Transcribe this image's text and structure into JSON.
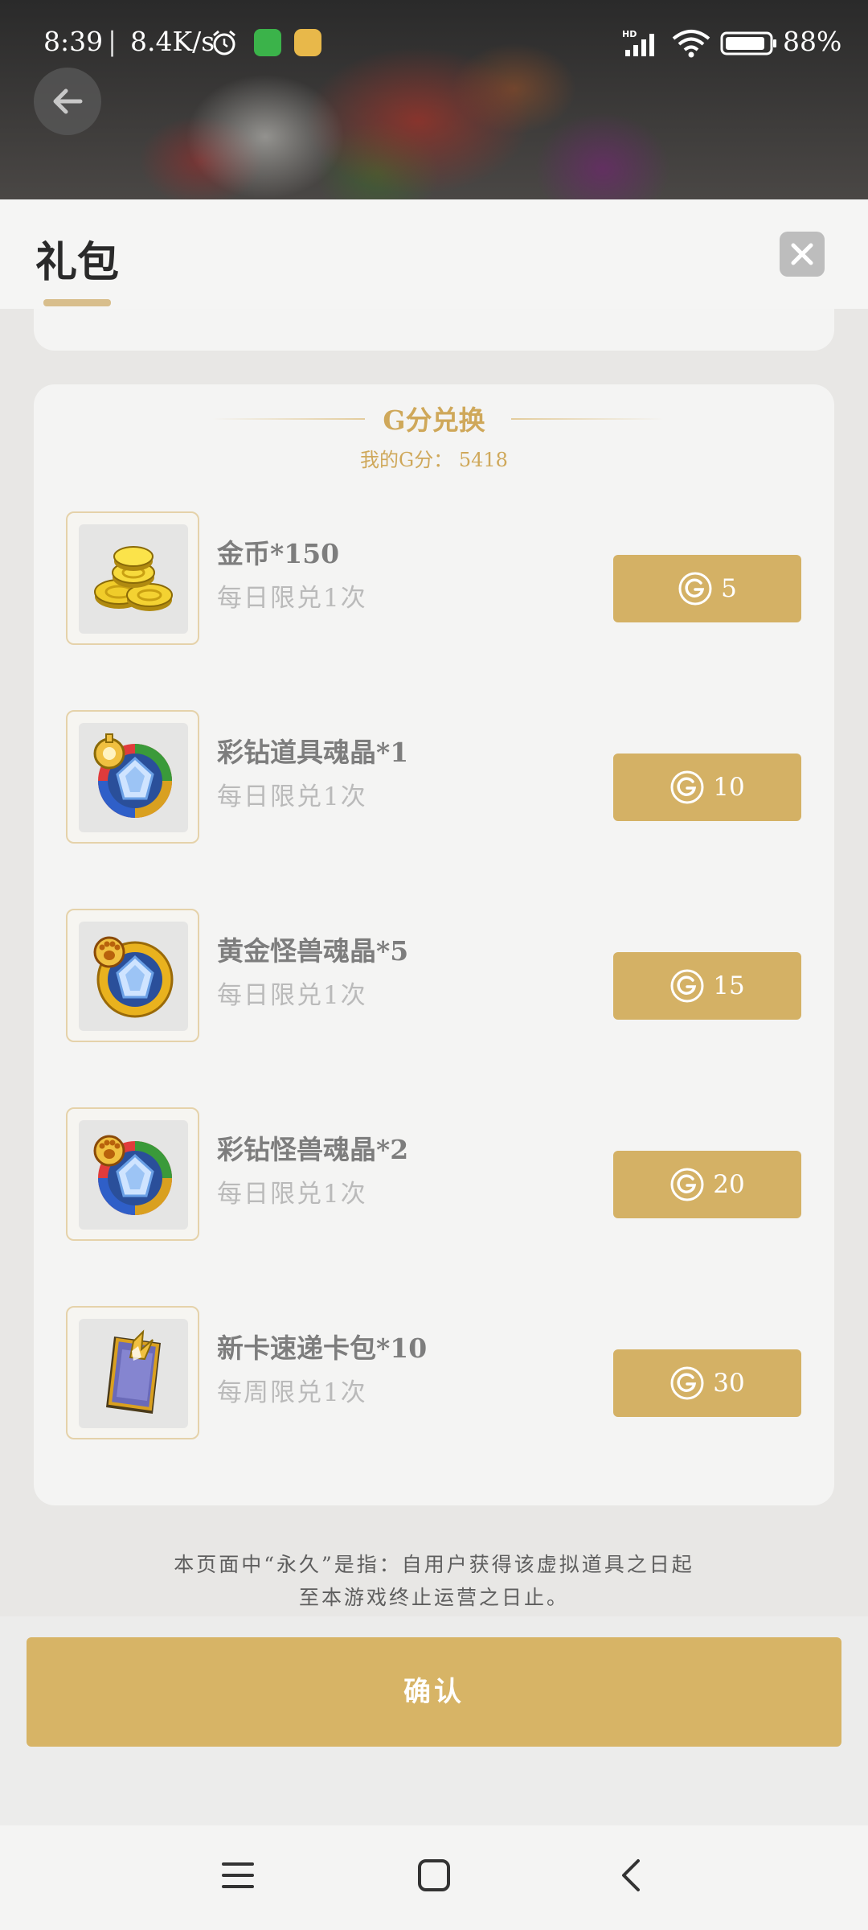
{
  "status_bar": {
    "time": "8:39",
    "separator": "|",
    "net_speed": "8.4K/s",
    "battery": "88%",
    "icons": [
      "alarm-icon",
      "app-icon",
      "game-app-icon",
      "hd-signal-icon",
      "wifi-icon",
      "battery-icon"
    ]
  },
  "header": {
    "title": "礼包"
  },
  "section": {
    "title": "G分兑换",
    "my_points": "我的G分： 5418"
  },
  "items": [
    {
      "name": "金币*150",
      "limit": "每日限兑1次",
      "cost": "5",
      "icon": "gold-coins-icon"
    },
    {
      "name": "彩钻道具魂晶*1",
      "limit": "每日限兑1次",
      "cost": "10",
      "icon": "rainbow-prop-crystal-icon"
    },
    {
      "name": "黄金怪兽魂晶*5",
      "limit": "每日限兑1次",
      "cost": "15",
      "icon": "gold-monster-crystal-icon"
    },
    {
      "name": "彩钻怪兽魂晶*2",
      "limit": "每日限兑1次",
      "cost": "20",
      "icon": "rainbow-monster-crystal-icon"
    },
    {
      "name": "新卡速递卡包*10",
      "limit": "每周限兑1次",
      "cost": "30",
      "icon": "card-pack-icon"
    }
  ],
  "footnote": {
    "line1": "本页面中“永久”是指：自用户获得该虚拟道具之日起",
    "line2": "至本游戏终止运营之日止。"
  },
  "confirm_label": "确认",
  "colors": {
    "accent_gold": "#d4b165",
    "section_title_gold": "#cfa85a",
    "card_bg": "#f4f4f3",
    "page_bg": "#e8e7e5"
  }
}
